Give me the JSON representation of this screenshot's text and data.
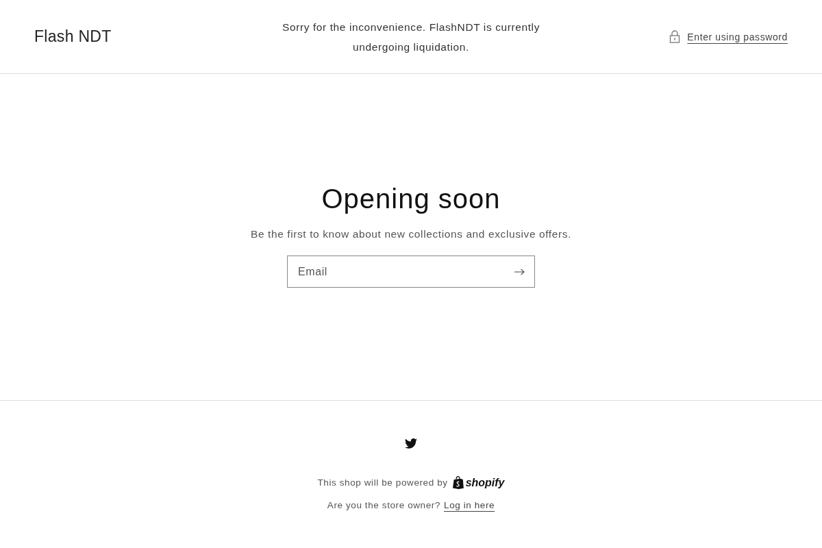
{
  "header": {
    "store_name": "Flash NDT",
    "announcement": "Sorry for the inconvenience. FlashNDT is currently undergoing liquidation.",
    "password_link": "Enter using password"
  },
  "main": {
    "heading": "Opening soon",
    "subheading": "Be the first to know about new collections and exclusive offers.",
    "email_field": {
      "placeholder": "Email"
    }
  },
  "footer": {
    "powered_by": "This shop will be powered by",
    "shopify_logo": "shopify",
    "owner_question": "Are you the store owner?",
    "login_link": "Log in here"
  }
}
